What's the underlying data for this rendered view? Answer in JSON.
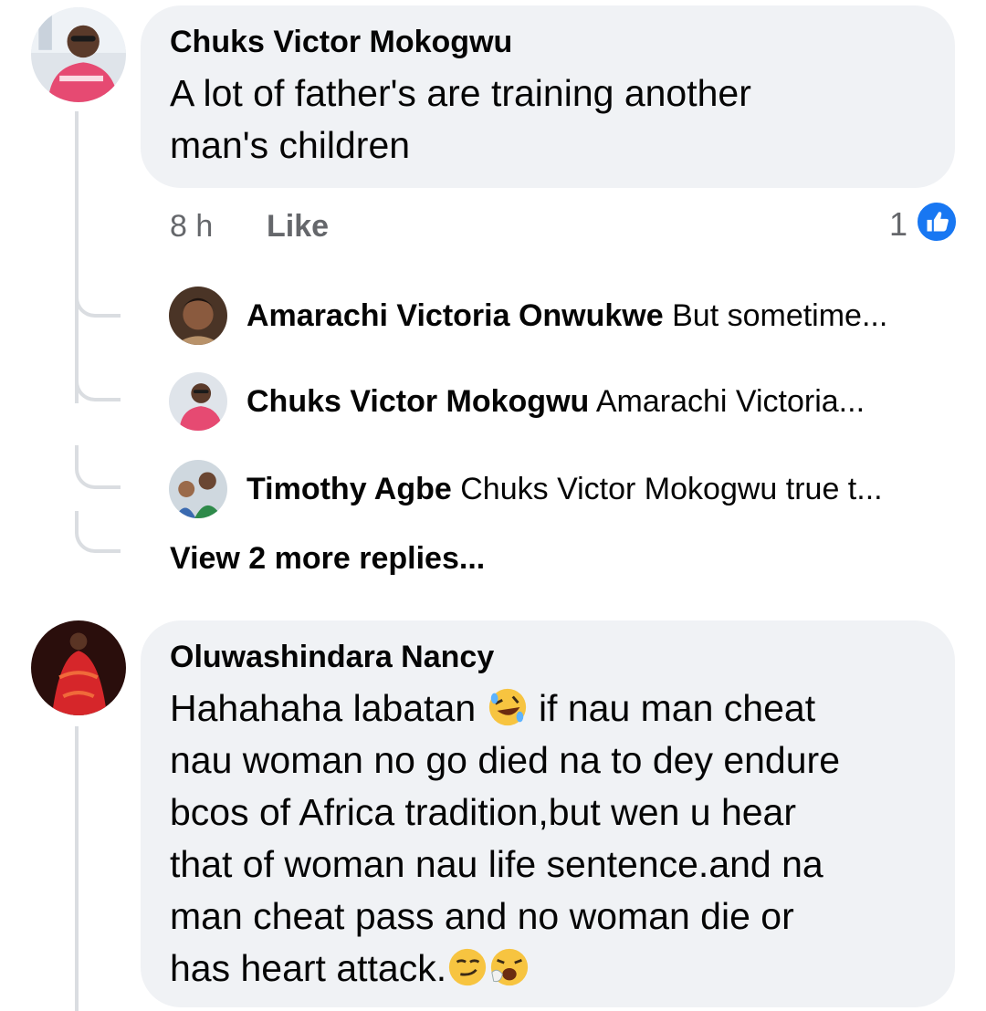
{
  "comment1": {
    "author": "Chuks Victor Mokogwu",
    "text_line1": "A lot of father's are training another",
    "text_line2": "man's children",
    "time": "8 h",
    "like_label": "Like",
    "reaction_count": "1",
    "replies": [
      {
        "author": "Amarachi Victoria Onwukwe",
        "preview": "But sometime..."
      },
      {
        "author": "Chuks Victor Mokogwu",
        "preview": "Amarachi Victoria..."
      },
      {
        "author": "Timothy Agbe",
        "preview": "Chuks Victor Mokogwu true t..."
      }
    ],
    "view_more": "View 2 more replies..."
  },
  "comment2": {
    "author": "Oluwashindara Nancy",
    "line1_a": "Hahahaha labatan",
    "line1_emoji": "rolling-on-floor-laughing",
    "line1_b": "if nau man cheat",
    "line2": "nau woman no go died na to dey endure",
    "line3": "bcos of Africa tradition,but wen u hear",
    "line4": "that of woman nau life sentence.and na",
    "line5": "man cheat pass and no woman die or",
    "line6": "has heart attack.",
    "line6_emojis": [
      "smirking-face",
      "yawning-face"
    ]
  },
  "colors": {
    "bubble": "#f0f2f5",
    "thread_line": "#dadde1",
    "like_blue": "#1877f2",
    "meta_gray": "#65676b"
  }
}
